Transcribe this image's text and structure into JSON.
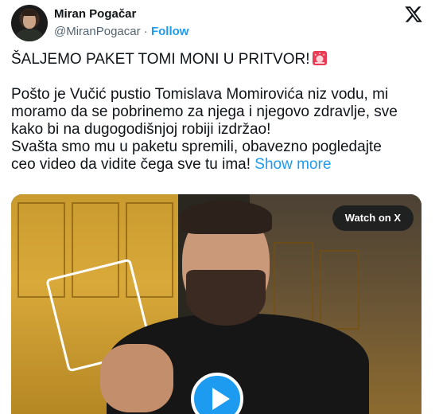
{
  "author": {
    "name": "Miran Pogačar",
    "handle": "@MiranPogacar",
    "separator": " · ",
    "follow_label": "Follow"
  },
  "icons": {
    "platform": "x-logo-icon",
    "emoji": "rotating-light-icon",
    "play": "play-icon"
  },
  "tweet": {
    "headline": "ŠALJEMO PAKET TOMI MONI U PRITVOR!",
    "lines": [
      "Pošto je Vučić pustio Tomislava Momirovića niz vodu, mi",
      "moramo da se pobrinemo za njega i njegovo zdravlje, sve",
      "kako bi na dugogodišnjoj robiji izdržao!",
      "Svašta smo mu u paketu spremili, obavezno pogledajte",
      "ceo video da vidite čega sve tu ima!"
    ],
    "show_more": "Show more"
  },
  "media": {
    "watch_label": "Watch on X"
  },
  "colors": {
    "accent": "#1d9bf0",
    "text": "#0f1419",
    "secondary": "#536471"
  }
}
